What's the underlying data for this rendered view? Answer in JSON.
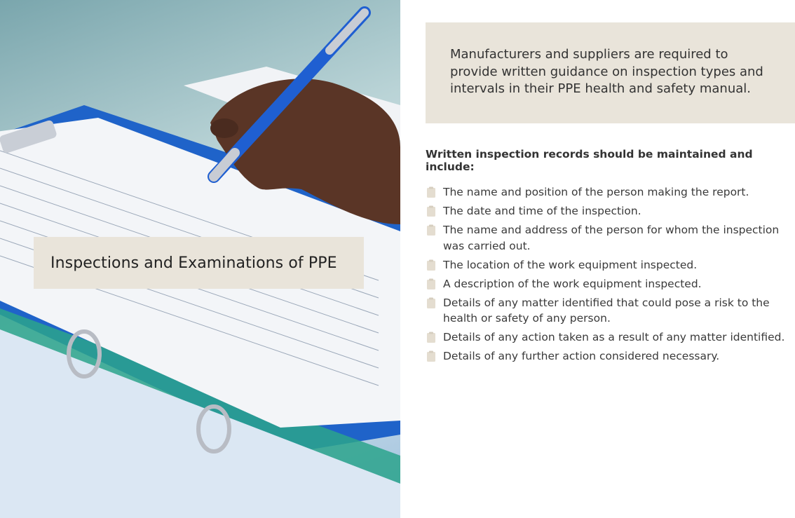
{
  "hero": {
    "title": "Inspections and Examinations of PPE"
  },
  "callout": {
    "text": "Manufacturers and suppliers are required to provide written guidance on inspection types and intervals in their PPE health and safety manual."
  },
  "records": {
    "heading": "Written inspection records should be maintained and include:",
    "items": [
      {
        "label": "The name and position of the person making the report.",
        "icon": "clipboard-icon"
      },
      {
        "label": "The date and time of the inspection.",
        "icon": "clipboard-icon"
      },
      {
        "label": "The name and address of the person for whom the inspection was carried out.",
        "icon": "clipboard-icon"
      },
      {
        "label": "The location of the work equipment inspected.",
        "icon": "clipboard-icon"
      },
      {
        "label": "A description of the work equipment inspected.",
        "icon": "clipboard-icon"
      },
      {
        "label": "Details of any matter identified that could pose a risk to the health or safety of any person.",
        "icon": "clipboard-icon"
      },
      {
        "label": "Details of any action taken as a result of any matter identified.",
        "icon": "clipboard-icon"
      },
      {
        "label": "Details of any further action considered necessary.",
        "icon": "clipboard-icon"
      }
    ]
  },
  "colors": {
    "card_background": "#e9e4da",
    "icon_color": "#e4ddd0",
    "text": "#333333"
  }
}
